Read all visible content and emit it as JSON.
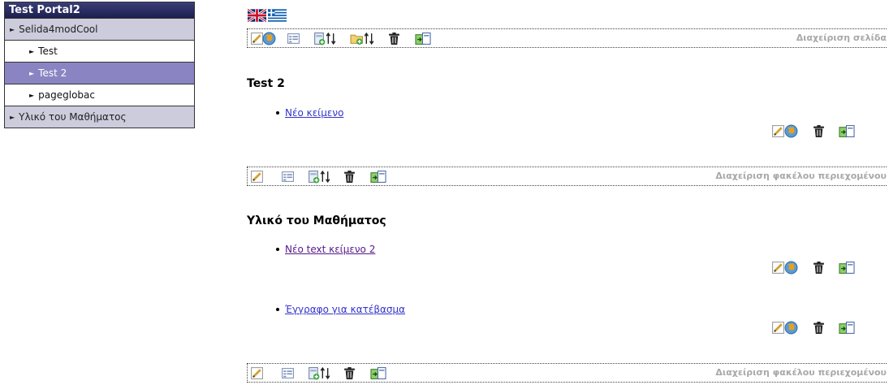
{
  "sidebar": {
    "title": "Test Portal2",
    "items": [
      {
        "label": "Selida4modCool",
        "level": 1,
        "selected": false
      },
      {
        "label": "Test",
        "level": 2,
        "selected": false
      },
      {
        "label": "Test 2",
        "level": 2,
        "selected": true
      },
      {
        "label": "pageglobac",
        "level": 2,
        "selected": false
      },
      {
        "label": "Υλικό του Μαθήματος",
        "level": 1,
        "selected": false
      }
    ]
  },
  "languages": [
    "english-flag-icon",
    "greek-flag-icon"
  ],
  "page_toolbar": {
    "label": "Διαχείριση σελίδα"
  },
  "sections": [
    {
      "title": "Test 2",
      "items": [
        {
          "label": "Νέο κείμενο"
        }
      ],
      "toolbar_label": "Διαχείριση φακέλου περιεχομένου"
    },
    {
      "title": "Υλικό του Μαθήματος",
      "items": [
        {
          "label": "Νέο text κείμενο 2"
        },
        {
          "label": "Έγγραφο για κατέβασμα"
        }
      ],
      "toolbar_label": "Διαχείριση φακέλου περιεχομένου"
    }
  ],
  "colors": {
    "sidebar_title": "#1c1f4e",
    "sidebar_level1": "#ccccdd",
    "sidebar_selected": "#8a85c2",
    "link": "#3333cc"
  }
}
